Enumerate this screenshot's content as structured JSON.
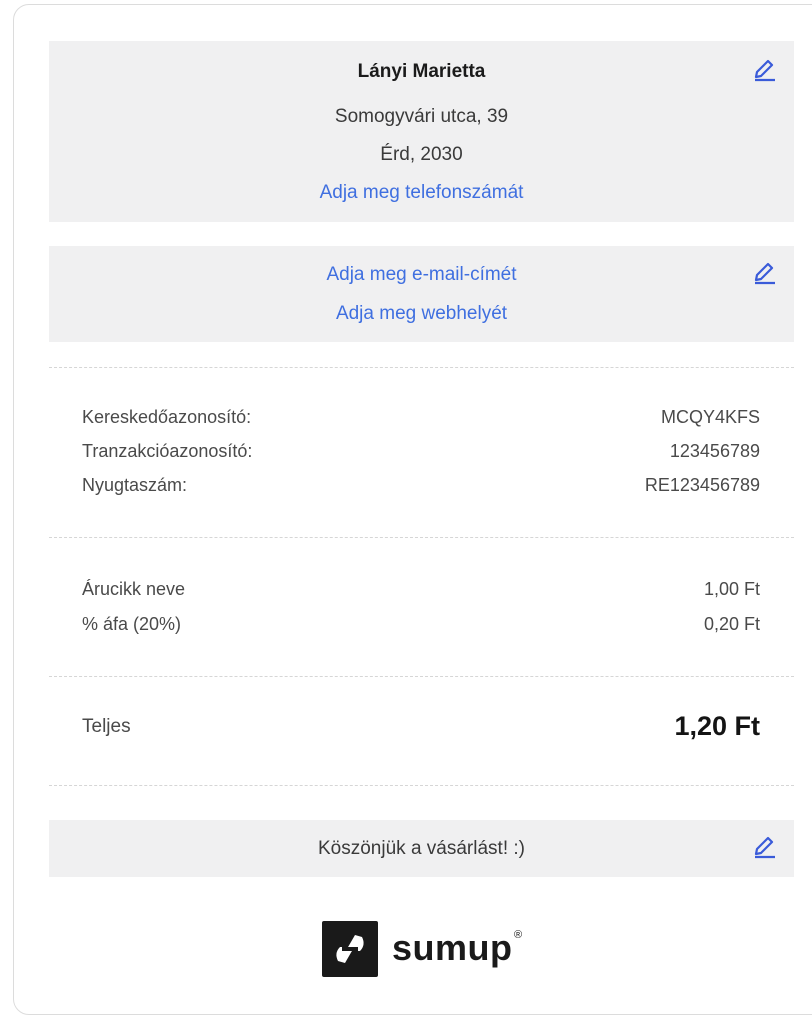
{
  "merchant": {
    "name": "Lányi Marietta",
    "street": "Somogyvári utca, 39",
    "city": "Érd, 2030",
    "phone_link": "Adja meg telefonszámát"
  },
  "contact": {
    "email_link": "Adja meg e-mail-címét",
    "website_link": "Adja meg webhelyét"
  },
  "ids": [
    {
      "label": "Kereskedőazonosító:",
      "value": "MCQY4KFS"
    },
    {
      "label": "Tranzakcióazonosító:",
      "value": "123456789"
    },
    {
      "label": "Nyugtaszám:",
      "value": "RE123456789"
    }
  ],
  "items": [
    {
      "label": "Árucikk neve",
      "value": "1,00 Ft"
    },
    {
      "label": "% áfa (20%)",
      "value": "0,20 Ft"
    }
  ],
  "total": {
    "label": "Teljes",
    "value": "1,20 Ft"
  },
  "footer": {
    "message": "Köszönjük a vásárlást! :)"
  },
  "brand": {
    "name": "sumup",
    "mark": "®"
  },
  "colors": {
    "link": "#3f6fe0",
    "panel": "#f0f0f1",
    "icon": "#3a5bd9"
  },
  "icons": {
    "edit": "pencil-icon",
    "logo": "sumup-logo-icon"
  }
}
